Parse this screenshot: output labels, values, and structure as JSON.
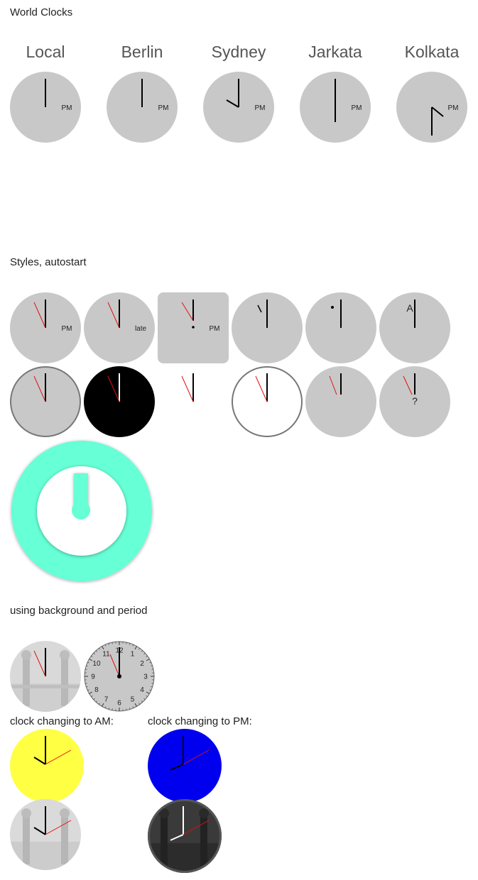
{
  "world_clocks": {
    "heading": "World Clocks",
    "cities": [
      "Local",
      "Berlin",
      "Sydney",
      "Jarkata",
      "Kolkata"
    ],
    "period_label": "PM"
  },
  "styles": {
    "heading": "Styles, autostart",
    "labels": {
      "pm": "PM",
      "late": "late",
      "am_marker": "A",
      "question": "?"
    }
  },
  "background_period": {
    "heading": "using background and period",
    "dial_numbers": [
      "12",
      "1",
      "2",
      "3",
      "4",
      "5",
      "6",
      "7",
      "8",
      "9",
      "10",
      "11"
    ]
  },
  "changing": {
    "am_label": "clock changing to AM:",
    "pm_label": "clock changing to PM:"
  },
  "colors": {
    "face_grey": "#c8c8c8",
    "second_hand": "#e01010",
    "ring_teal": "#66ffd6",
    "yellow_face": "#ffff44",
    "blue_face": "#0000ee"
  }
}
